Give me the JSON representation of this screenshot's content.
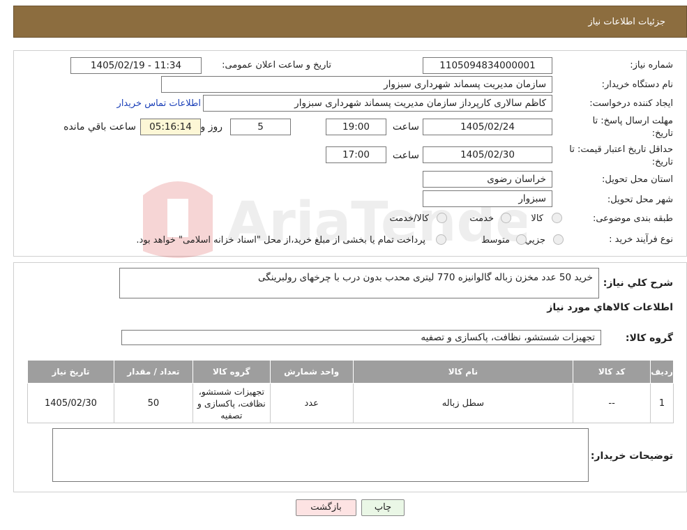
{
  "header": {
    "title": "جزئیات اطلاعات نیاز"
  },
  "form": {
    "need_number_label": "شماره نیاز:",
    "need_number": "1105094834000001",
    "announce_label": "تاریخ و ساعت اعلان عمومی:",
    "announce_value": "1405/02/19 - 11:34",
    "buyer_org_label": "نام دستگاه خریدار:",
    "buyer_org": "سازمان مدیریت پسماند شهرداری سبزوار",
    "creator_label": "ایجاد کننده درخواست:",
    "creator": "کاظم سالاری کارپرداز سازمان مدیریت پسماند شهرداری سبزوار",
    "contact_link": "اطلاعات تماس خریدار",
    "deadline_label_1": "مهلت ارسال پاسخ: تا",
    "deadline_label_2": "تاریخ:",
    "deadline_date": "1405/02/24",
    "time_label": "ساعت",
    "deadline_time": "19:00",
    "days_value": "5",
    "days_label": "روز و",
    "remaining_time": "05:16:14",
    "remaining_label": "ساعت باقي مانده",
    "validity_label_1": "حداقل تاریخ اعتبار قیمت: تا",
    "validity_label_2": "تاریخ:",
    "validity_date": "1405/02/30",
    "validity_time": "17:00",
    "province_label": "استان محل تحویل:",
    "province": "خراسان رضوی",
    "city_label": "شهر محل تحویل:",
    "city": "سبزوار",
    "category_label": "طبقه بندی موضوعی:",
    "category_options": [
      "کالا",
      "خدمت",
      "کالا/خدمت"
    ],
    "process_label": "نوع فرآیند خرید :",
    "process_options": [
      "جزیي",
      "متوسط"
    ],
    "payment_note": "پرداخت تمام یا بخشی از مبلغ خرید،از محل \"اسناد خزانه اسلامی\" خواهد بود."
  },
  "details": {
    "summary_label": "شرح کلي نياز:",
    "summary": "خرید 50 عدد مخزن زباله گالوانیزه 770 لیتری محدب بدون درب با چرخهای رولبرینگی",
    "goods_title": "اطلاعات کالاهاي مورد نياز",
    "group_label": "گروه کالا:",
    "group_value": "تجهیزات شستشو، نظافت، پاکسازی و تصفیه",
    "table": {
      "headers": [
        "ردیف",
        "کد کالا",
        "نام کالا",
        "واحد شمارش",
        "گروه کالا",
        "تعداد / مقدار",
        "تاریخ نیاز"
      ],
      "rows": [
        [
          "1",
          "--",
          "سطل زباله",
          "عدد",
          "تجهیزات شستشو، نظافت، پاکسازی و تصفیه",
          "50",
          "1405/02/30"
        ]
      ]
    },
    "buyer_notes_label": "توضیحات خریدار:",
    "buyer_notes": ""
  },
  "buttons": {
    "print": "چاپ",
    "back": "بازگشت"
  },
  "watermark": {
    "text": "AriaTender.neT"
  },
  "colors": {
    "header_bg": "#8c6d3f",
    "link": "#1a3fb8",
    "remaining_bg": "#fdf7d6",
    "back_bg": "#fde3e3",
    "print_bg": "#eaf7e6"
  }
}
